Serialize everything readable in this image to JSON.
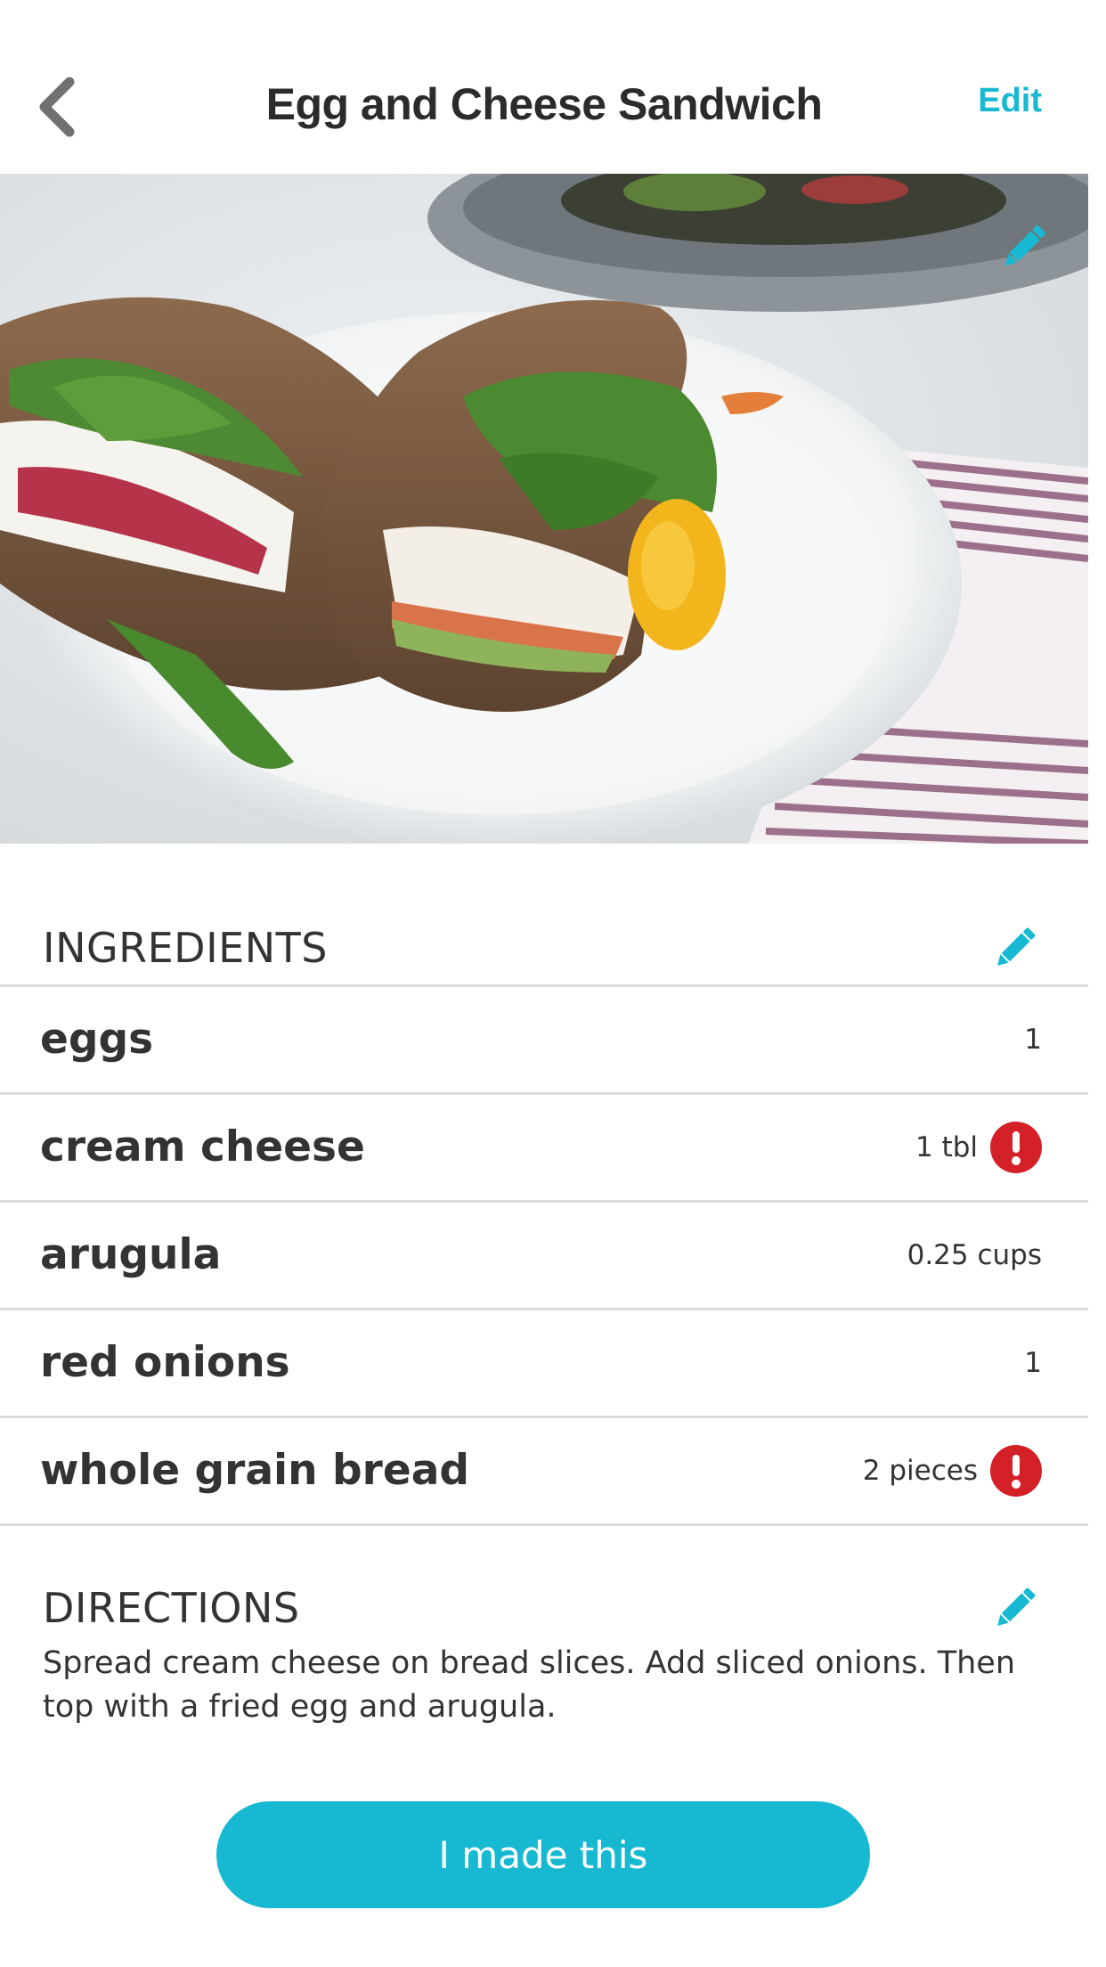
{
  "header": {
    "title": "Egg and Cheese Sandwich",
    "edit_label": "Edit"
  },
  "hero": {
    "image_subject": "Sandwich halves with egg, arugula, radish and cream cheese on a white plate"
  },
  "ingredients": {
    "heading": "INGREDIENTS",
    "items": [
      {
        "name": "eggs",
        "quantity": "1",
        "alert": false
      },
      {
        "name": "cream cheese",
        "quantity": "1 tbl",
        "alert": true
      },
      {
        "name": "arugula",
        "quantity": "0.25 cups",
        "alert": false
      },
      {
        "name": "red onions",
        "quantity": "1",
        "alert": false
      },
      {
        "name": "whole grain bread",
        "quantity": "2 pieces",
        "alert": true
      }
    ]
  },
  "directions": {
    "heading": "DIRECTIONS",
    "text": "Spread cream cheese on bread slices. Add sliced onions. Then top with a fried egg and arugula."
  },
  "actions": {
    "made_this_label": "I made this"
  },
  "colors": {
    "accent": "#16b9d1",
    "alert": "#d42027",
    "text": "#333333",
    "divider": "#dcdcdc"
  },
  "icons": {
    "back": "chevron-left-icon",
    "edit": "pencil-icon",
    "alert": "exclamation-icon"
  }
}
